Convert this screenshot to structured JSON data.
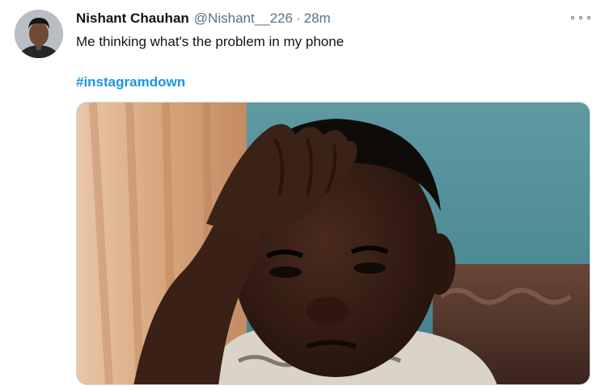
{
  "tweet": {
    "author": {
      "name": "Nishant Chauhan",
      "handle": "@Nishant__226"
    },
    "separator": "·",
    "time": "28m",
    "text": "Me thinking what's the problem in my phone",
    "hashtag": "#instagramdown",
    "icons": {
      "more": "more-options-icon"
    },
    "colors": {
      "hashtag": "#1b95e0",
      "secondary_text": "#5b7083"
    }
  }
}
